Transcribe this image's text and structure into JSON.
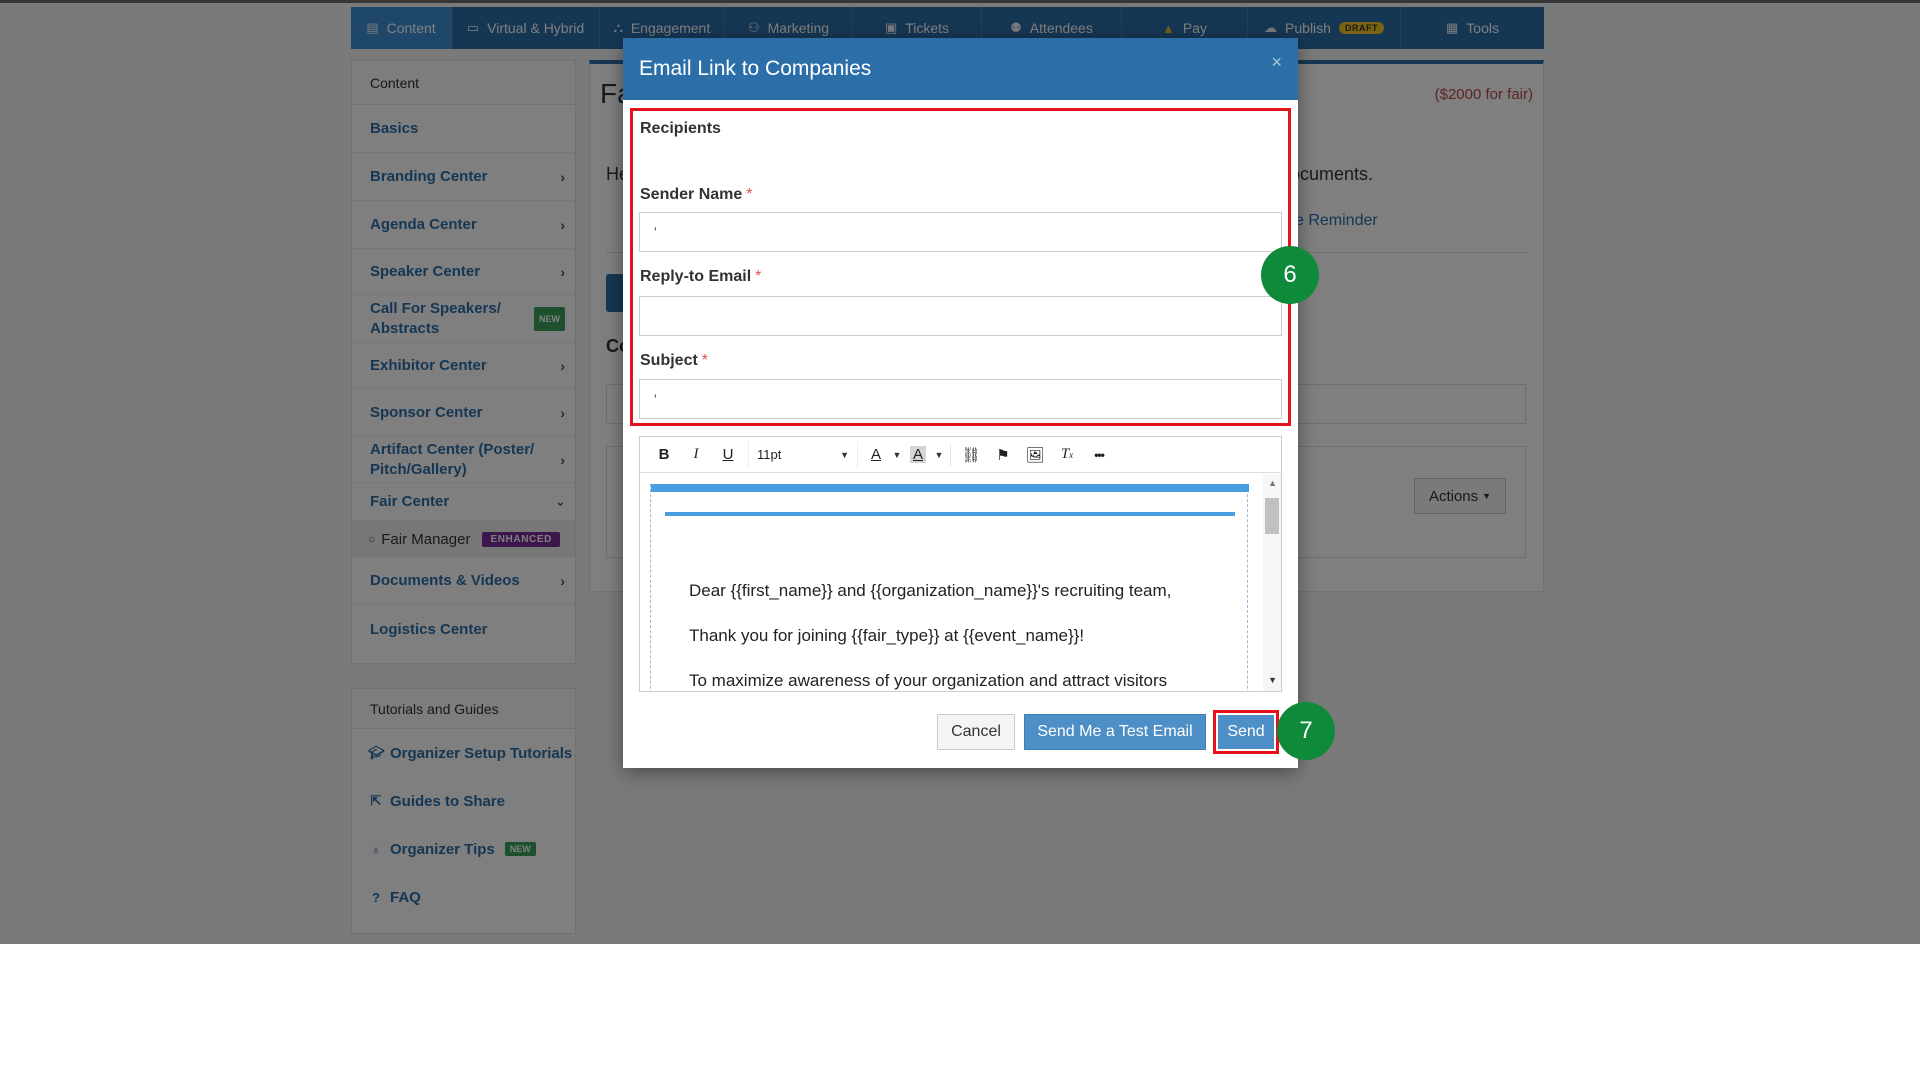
{
  "navbar": {
    "items": [
      {
        "label": "Content",
        "icon": "content-icon"
      },
      {
        "label": "Virtual & Hybrid",
        "icon": "laptop-icon"
      },
      {
        "label": "Engagement",
        "icon": "network-icon"
      },
      {
        "label": "Marketing",
        "icon": "users-icon"
      },
      {
        "label": "Tickets",
        "icon": "ticket-icon"
      },
      {
        "label": "Attendees",
        "icon": "group-icon"
      },
      {
        "label": "Pay",
        "icon": "warning-icon"
      },
      {
        "label": "Publish",
        "icon": "cloud-upload-icon",
        "badge": "DRAFT"
      },
      {
        "label": "Tools",
        "icon": "toolbox-icon"
      }
    ]
  },
  "sidebar": {
    "header": "Content",
    "items": [
      {
        "label": "Basics"
      },
      {
        "label": "Branding Center"
      },
      {
        "label": "Agenda Center"
      },
      {
        "label": "Speaker Center"
      },
      {
        "label": "Call For Speakers/ Abstracts",
        "badge": "NEW"
      },
      {
        "label": "Exhibitor Center"
      },
      {
        "label": "Sponsor Center"
      },
      {
        "label": "Artifact Center (Poster/ Pitch/Gallery)"
      },
      {
        "label": "Fair Center"
      },
      {
        "label": "Fair Manager",
        "badge": "ENHANCED"
      },
      {
        "label": "Documents & Videos"
      },
      {
        "label": "Logistics Center"
      }
    ]
  },
  "sidebar2": {
    "header": "Tutorials and Guides",
    "items": [
      {
        "label": "Organizer Setup Tutorials",
        "icon": "graduation-cap-icon"
      },
      {
        "label": "Guides to Share",
        "icon": "share-icon"
      },
      {
        "label": "Organizer Tips",
        "icon": "lightbulb-icon",
        "badge": "NEW"
      },
      {
        "label": "FAQ",
        "icon": "question-circle-icon"
      }
    ]
  },
  "main": {
    "title_partial": "Fa",
    "price_note": "($2000 for fair)",
    "text_left": "He",
    "text_right": "ocuments.",
    "reminder": "e Reminder",
    "section_partial": "Co",
    "actions_label": "Actions"
  },
  "modal": {
    "title": "Email Link to Companies",
    "close": "×",
    "recipients_label": "Recipients",
    "sender_name_label": "Sender Name",
    "reply_to_label": "Reply-to Email",
    "subject_label": "Subject",
    "required_mark": "*",
    "sender_name_value": "'",
    "reply_to_value": "",
    "subject_value": "'",
    "toolbar": {
      "bold": "B",
      "italic": "I",
      "underline": "U",
      "font_size": "11pt",
      "font_color": "A",
      "bg_color": "A",
      "more": "•••"
    },
    "email_lines": [
      "Dear {{first_name}} and {{organization_name}}'s recruiting team,",
      "Thank you for joining {{fair_type}} at {{event_name}}!",
      "To maximize awareness of your organization and attract visitors"
    ],
    "cancel_label": "Cancel",
    "test_email_label": "Send Me a Test Email",
    "send_label": "Send"
  },
  "steps": {
    "step_a": "6",
    "step_b": "7"
  },
  "colors": {
    "primary": "#2c6fa8",
    "highlight": "#e3121b",
    "step": "#0f8a3a"
  }
}
